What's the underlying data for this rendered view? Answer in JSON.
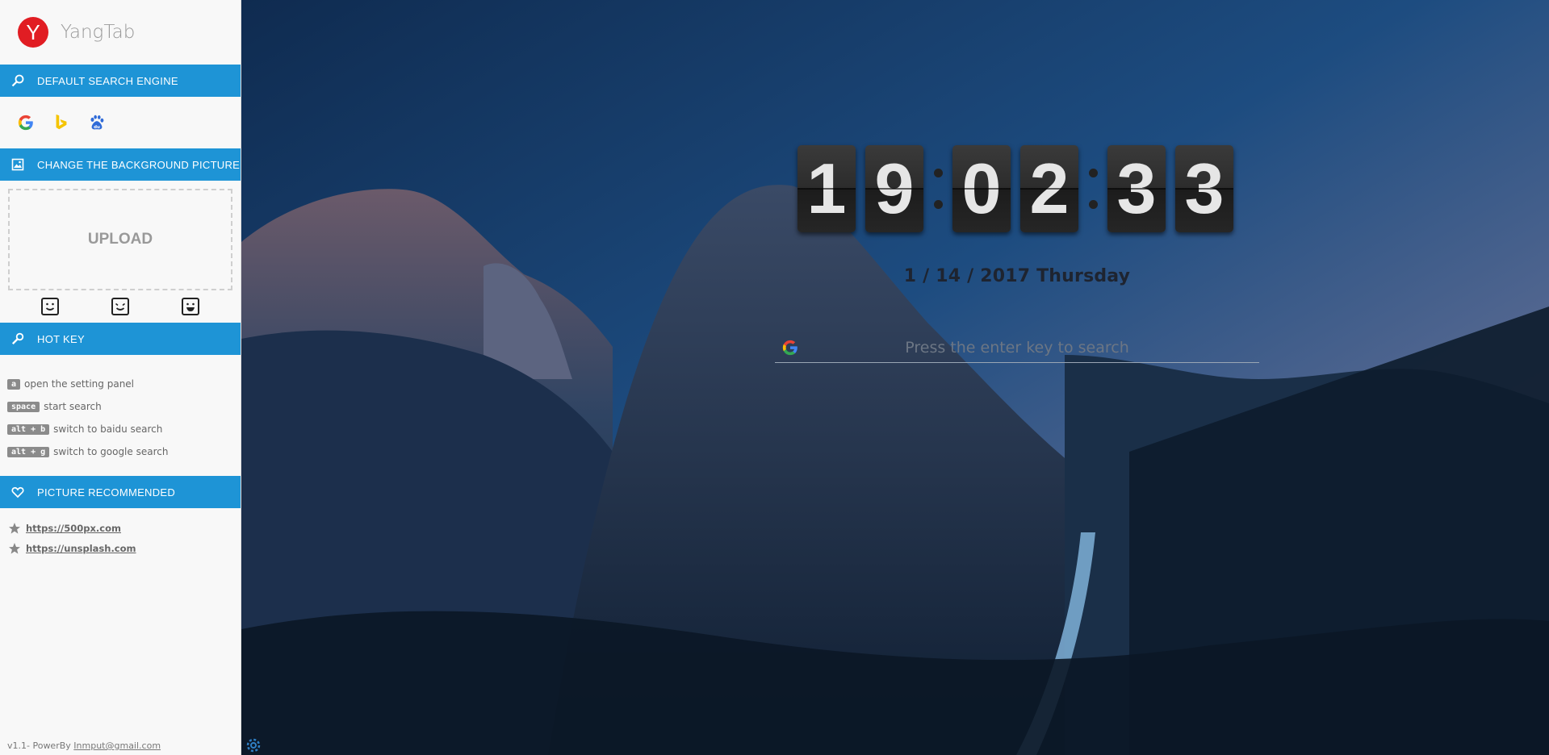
{
  "brand": {
    "logo_letter": "Y",
    "name": "YangTab",
    "color": "#e11d23"
  },
  "accent_color": "#1e94d6",
  "sections": {
    "search_engine": {
      "title": "DEFAULT SEARCH ENGINE",
      "icon": "search-icon",
      "engines": [
        {
          "name": "google-icon"
        },
        {
          "name": "bing-icon"
        },
        {
          "name": "baidu-icon"
        }
      ]
    },
    "background": {
      "title": "CHANGE THE BACKGROUND PICTURE",
      "icon": "image-icon",
      "upload_label": "UPLOAD"
    },
    "hotkey": {
      "title": "HOT KEY",
      "icon": "wrench-icon",
      "items": [
        {
          "key": "a",
          "desc": "open the setting panel"
        },
        {
          "key": "space",
          "desc": "start search"
        },
        {
          "key": "alt + b",
          "desc": "switch to baidu search"
        },
        {
          "key": "alt + g",
          "desc": "switch to google search"
        }
      ]
    },
    "recommended": {
      "title": "PICTURE RECOMMENDED",
      "icon": "heart-icon",
      "links": [
        {
          "text": "https://500px.com"
        },
        {
          "text": "https://unsplash.com"
        }
      ]
    }
  },
  "footer": {
    "version": "v1.1- PowerBy",
    "email": "Inmput@gmail.com"
  },
  "clock": {
    "digits": [
      "1",
      "9",
      "0",
      "2",
      "3",
      "3"
    ]
  },
  "date_text": "1 / 14 / 2017 Thursday",
  "search": {
    "placeholder": "Press the enter key to search",
    "engine_icon": "google-icon"
  }
}
